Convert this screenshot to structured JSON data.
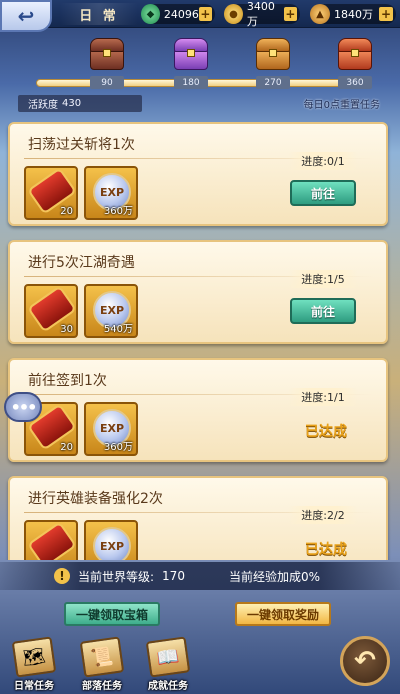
{
  "topbar": {
    "back_icon": "back-arrow-icon",
    "tab_label": "日 常",
    "resources": [
      {
        "icon": "jade-icon",
        "value": "24096"
      },
      {
        "icon": "coin-icon",
        "value": "3400万"
      },
      {
        "icon": "ingot-icon",
        "value": "1840万"
      }
    ],
    "plus_label": "+"
  },
  "activity": {
    "label": "活跃度",
    "value": "430",
    "reset_note": "每日0点重置任务",
    "milestones": [
      "90",
      "180",
      "270",
      "360"
    ]
  },
  "tasks": [
    {
      "title": "扫荡过关斩将1次",
      "progress": "进度:0/1",
      "rewards": [
        {
          "icon": "scroll-icon",
          "qty": "20"
        },
        {
          "icon": "exp-icon",
          "label": "EXP",
          "qty": "360万"
        }
      ],
      "action": "前往",
      "status": "go"
    },
    {
      "title": "进行5次江湖奇遇",
      "progress": "进度:1/5",
      "rewards": [
        {
          "icon": "scroll-icon",
          "qty": "30"
        },
        {
          "icon": "exp-icon",
          "label": "EXP",
          "qty": "540万"
        }
      ],
      "action": "前往",
      "status": "go"
    },
    {
      "title": "前往签到1次",
      "progress": "进度:1/1",
      "rewards": [
        {
          "icon": "scroll-icon",
          "qty": "20"
        },
        {
          "icon": "exp-icon",
          "label": "EXP",
          "qty": "360万"
        }
      ],
      "action": "已达成",
      "status": "done"
    },
    {
      "title": "进行英雄装备强化2次",
      "progress": "进度:2/2",
      "rewards": [
        {
          "icon": "scroll-icon",
          "qty": ""
        },
        {
          "icon": "exp-icon",
          "label": "EXP",
          "qty": ""
        }
      ],
      "action": "已达成",
      "status": "done"
    }
  ],
  "chat_bubble": "•••",
  "world": {
    "level_label": "当前世界等级:",
    "level_value": "170",
    "exp_bonus": "当前经验加成0%"
  },
  "buttons": {
    "claim_chests": "一键领取宝箱",
    "claim_rewards": "一键领取奖励"
  },
  "bottom_nav": [
    {
      "label": "日常任务",
      "icon": "map-scroll-icon"
    },
    {
      "label": "部落任务",
      "icon": "tribe-scroll-icon"
    },
    {
      "label": "成就任务",
      "icon": "achievement-book-icon"
    }
  ],
  "return_icon": "return-arrow-icon"
}
